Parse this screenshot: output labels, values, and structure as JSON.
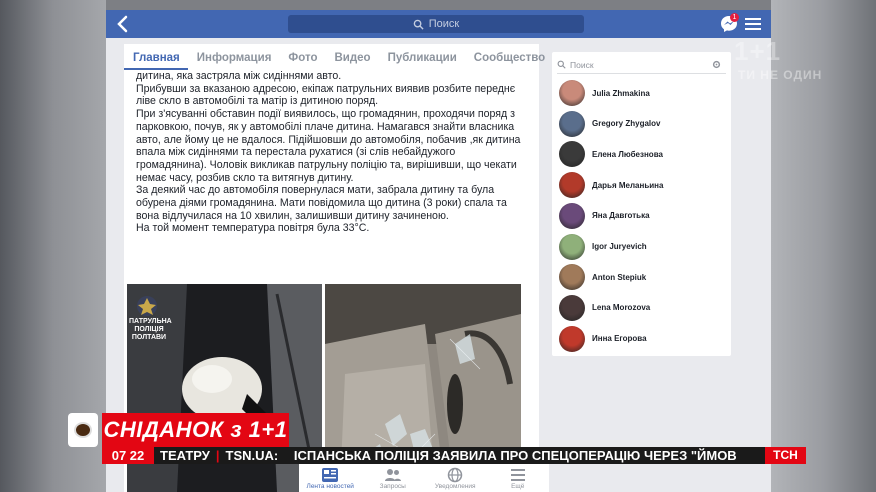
{
  "topbar": {
    "search_placeholder": "Поиск",
    "message_badge": "1"
  },
  "tabs": [
    "Главная",
    "Информация",
    "Фото",
    "Видео",
    "Публикации",
    "Сообщество"
  ],
  "post": {
    "paragraphs": [
      "дитина, яка застряла між сидіннями авто.",
      "Прибувши за вказаною адресою, екіпаж патрульних виявив розбите переднє ліве скло в автомобілі та матір із дитиною поряд.",
      "При з'ясуванні обставин події виявилось, що громадянин, проходячи поряд з парковкою, почув, як у автомобілі плаче дитина. Намагався знайти власника авто, але йому це не вдалося. Підійшовши до автомобіля, побачив ,як дитина впала між сидіннями та перестала рухатися (зі слів небайдужого громадянина). Чоловік викликав патрульну поліцію та, вирішивши, що чекати немає часу, розбив скло та витягнув дитину.",
      "За деякий час до автомобіля повернулася мати, забрала дитину та була обурена діями громадянина. Мати повідомила що дитина (3 роки) спала та вона відлучилася на 10 хвилин, залишивши дитину зачиненою.",
      "На той момент температура повітря була 33°С."
    ],
    "photo_caption": "ПАТРУЛЬНА ПОЛІЦІЯ ПОЛТАВИ"
  },
  "sidebar": {
    "search_placeholder": "Поиск",
    "friends": [
      {
        "name": "Julia Zhmakina",
        "color": "#c98a7a"
      },
      {
        "name": "Gregory Zhygalov",
        "color": "#5a6e8c"
      },
      {
        "name": "Елена Любезнова",
        "color": "#3a3a3a"
      },
      {
        "name": "Дарья Меланьина",
        "color": "#b23a2a"
      },
      {
        "name": "Яна Давготька",
        "color": "#6a4a7a"
      },
      {
        "name": "Igor Juryevich",
        "color": "#8fb07a"
      },
      {
        "name": "Anton Stepiuk",
        "color": "#a07a5a"
      },
      {
        "name": "Lena Morozova",
        "color": "#4a3a3a"
      },
      {
        "name": "Инна Егорова",
        "color": "#c0392b"
      }
    ]
  },
  "bottom_nav": [
    "Лента новостей",
    "Запросы",
    "Уведомления",
    "Ещё"
  ],
  "broadcast": {
    "watermark": "1+1",
    "watermark_sub": "ТИ НЕ ОДИН",
    "show_title": "СНІДАНОК з 1+1",
    "time": "07 22",
    "ticker": [
      "ТЕАТРУ",
      "TSN.UA:",
      "ІСПАНСЬКА ПОЛІЦІЯ ЗАЯВИЛА ПРО СПЕЦОПЕРАЦІЮ ЧЕРЕЗ \"ЙМОВ"
    ],
    "channel_tag": "ТСН"
  }
}
